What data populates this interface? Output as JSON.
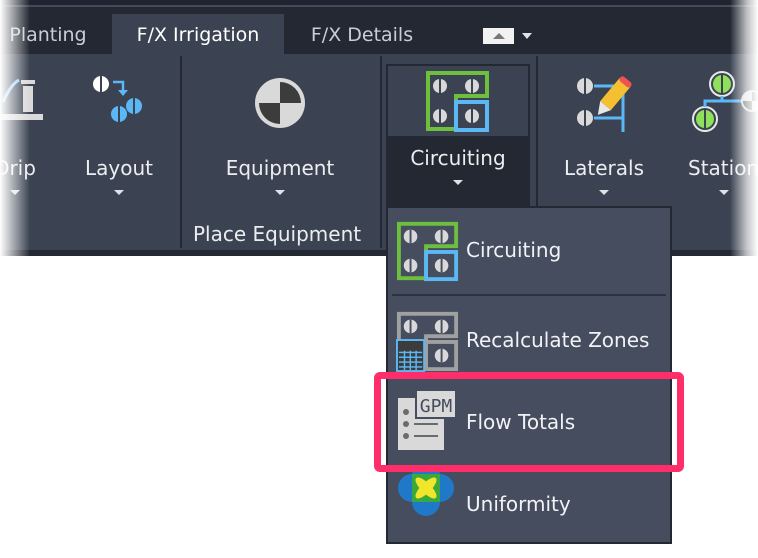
{
  "ribbon": {
    "tabs": [
      {
        "label": "Planting",
        "active": false
      },
      {
        "label": "F/X Irrigation",
        "active": true
      },
      {
        "label": "F/X Details",
        "active": false
      }
    ],
    "tools": {
      "drip": {
        "label": "Drip",
        "icon": "drip-icon"
      },
      "layout": {
        "label": "Layout",
        "icon": "layout-icon"
      },
      "equipment": {
        "label": "Equipment",
        "icon": "equipment-icon"
      },
      "circuiting": {
        "label": "Circuiting",
        "icon": "circuiting-icon"
      },
      "laterals": {
        "label": "Laterals",
        "icon": "laterals-icon"
      },
      "stations": {
        "label": "Station",
        "icon": "stations-icon"
      }
    },
    "groups": {
      "place_equipment": "Place Equipment"
    }
  },
  "dropdown": {
    "items": [
      {
        "label": "Circuiting",
        "icon": "circuiting-icon"
      },
      {
        "label": "Recalculate Zones",
        "icon": "recalculate-zones-icon"
      },
      {
        "label": "Flow Totals",
        "icon": "gpm-flow-totals-icon",
        "highlighted": true
      },
      {
        "label": "Uniformity",
        "icon": "uniformity-icon"
      }
    ]
  },
  "colors": {
    "ribbon_bg": "#3b4352",
    "tabbar_bg": "#232833",
    "dropdown_bg": "#454d5e",
    "highlight": "#ff2d6a",
    "accent_green": "#6fbf3e",
    "accent_blue": "#5bb8f5"
  }
}
